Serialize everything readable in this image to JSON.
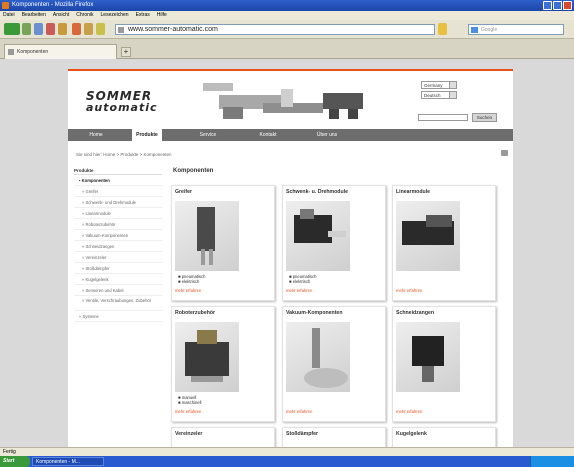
{
  "window": {
    "title": "Komponenten - Mozilla Firefox"
  },
  "menubar": [
    "Datei",
    "Bearbeiten",
    "Ansicht",
    "Chronik",
    "Lesezeichen",
    "Extras",
    "Hilfe"
  ],
  "address": {
    "url": "www.sommer-automatic.com",
    "search_placeholder": "Google"
  },
  "tabs": [
    {
      "label": "Komponenten"
    }
  ],
  "site": {
    "logo_line1": "SOMMER",
    "logo_line2": "automatic",
    "country_select": "Germany",
    "language_select": "Deutsch",
    "search_button": "Suchen",
    "nav": [
      "Home",
      "Produkte",
      "Service",
      "Kontakt",
      "Über uns"
    ],
    "nav_active": "Produkte",
    "breadcrumb": "Sie sind hier:  Home  >  Produkte  >  Komponenten",
    "main_title": "Komponenten",
    "sidebar_head": "Produkte",
    "sidebar_items": [
      "Komponenten",
      "Greifer",
      "Schwenk- und Drehmodule",
      "Linearmodule",
      "Roboterzubehör",
      "Vakuum-Komponenten",
      "Schneidzangen",
      "Vereinzeler",
      "Stoßdämpfer",
      "Kugelgelenk",
      "Sensoren und Kabel",
      "Ventile, Verschraubungen, Zubehör",
      "Systeme"
    ],
    "cards": [
      {
        "title": "Greifer",
        "features": [
          "pneumatisch",
          "elektrisch"
        ],
        "more": "mehr erfahren"
      },
      {
        "title": "Schwenk- u. Drehmodule",
        "features": [
          "pneumatisch",
          "elektrisch"
        ],
        "more": "mehr erfahren"
      },
      {
        "title": "Linearmodule",
        "features": [],
        "more": "mehr erfahren"
      },
      {
        "title": "Roboterzubehör",
        "features": [
          "manuell",
          "maschinell"
        ],
        "more": "mehr erfahren"
      },
      {
        "title": "Vakuum-Komponenten",
        "features": [],
        "more": "mehr erfahren"
      },
      {
        "title": "Schneidzangen",
        "features": [],
        "more": "mehr erfahren"
      },
      {
        "title": "Vereinzeler",
        "features": [],
        "more": ""
      },
      {
        "title": "Stoßdämpfer",
        "features": [],
        "more": ""
      },
      {
        "title": "Kugelgelenk",
        "features": [],
        "more": ""
      }
    ]
  },
  "status": {
    "text": "Fertig"
  },
  "taskbar": {
    "start": "Start",
    "item": "Komponenten - M..."
  },
  "colors": {
    "accent": "#e8511c",
    "nav_bg": "#6d6d6d",
    "titlebar": "#2d5fc9"
  }
}
